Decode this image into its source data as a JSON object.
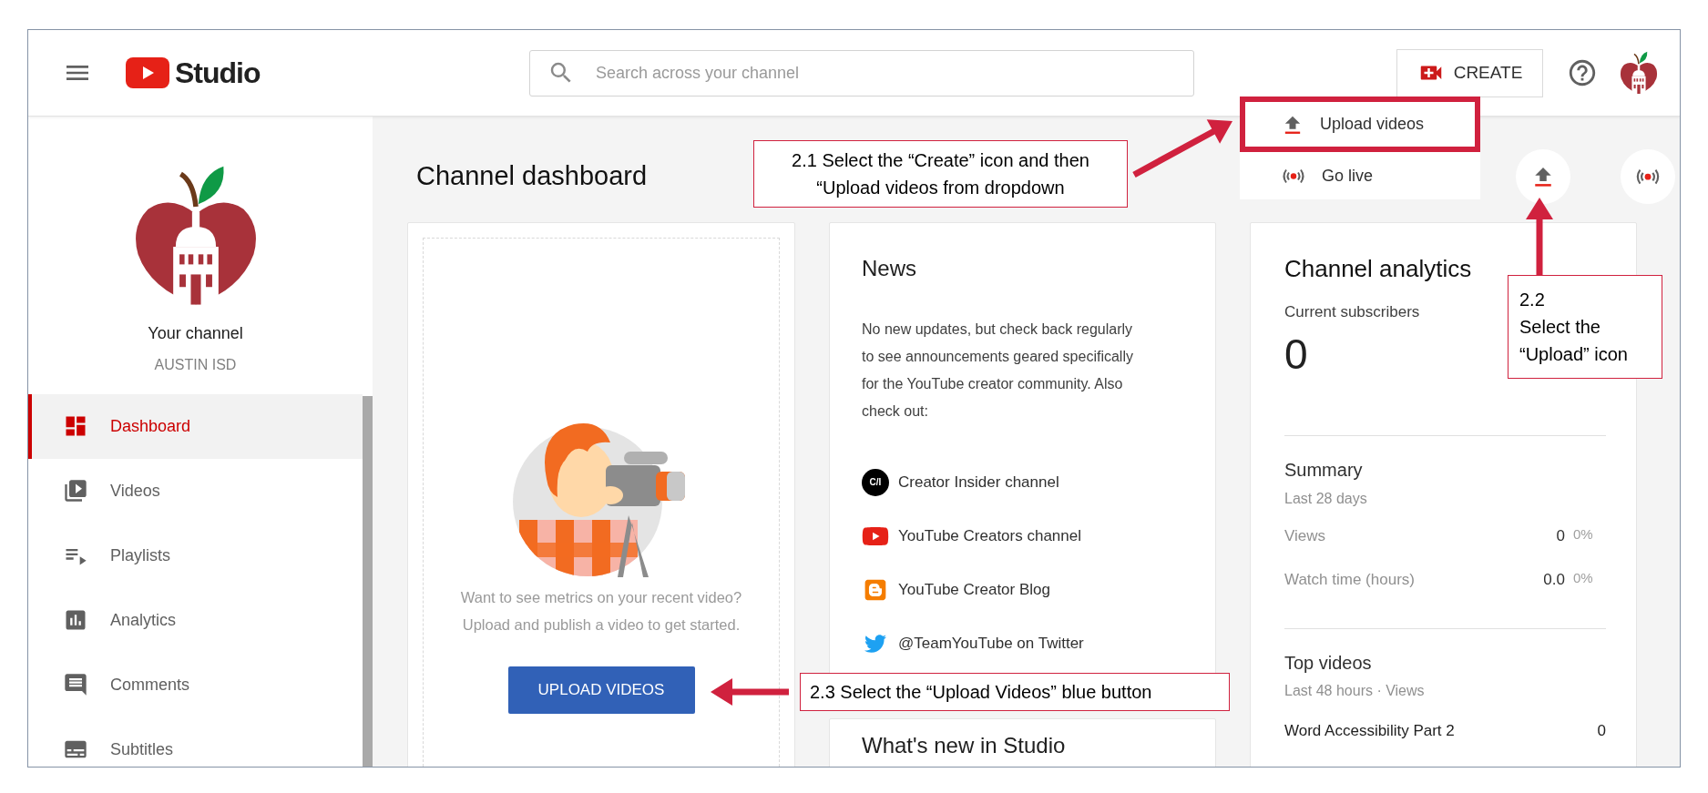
{
  "header": {
    "logo_text": "Studio",
    "search": {
      "placeholder": "Search across your channel"
    },
    "create_label": "CREATE"
  },
  "create_menu": {
    "items": [
      {
        "kind": "upload",
        "label": "Upload videos",
        "highlighted": true
      },
      {
        "kind": "live",
        "label": "Go live",
        "highlighted": false
      }
    ]
  },
  "sidebar": {
    "channel_title": "Your channel",
    "channel_name": "AUSTIN ISD",
    "items": [
      {
        "kind": "dashboard",
        "label": "Dashboard",
        "selected": true
      },
      {
        "kind": "videos",
        "label": "Videos",
        "selected": false
      },
      {
        "kind": "playlists",
        "label": "Playlists",
        "selected": false
      },
      {
        "kind": "analytics",
        "label": "Analytics",
        "selected": false
      },
      {
        "kind": "comments",
        "label": "Comments",
        "selected": false
      },
      {
        "kind": "subtitles",
        "label": "Subtitles",
        "selected": false
      }
    ]
  },
  "page_title": "Channel dashboard",
  "upload_card": {
    "message": "Want to see metrics on your recent video?\nUpload and publish a video to get started.",
    "button": "UPLOAD VIDEOS"
  },
  "news_card": {
    "title": "News",
    "body": "No new updates, but check back regularly to see announcements geared specifically for the YouTube creator community. Also check out:",
    "links": [
      {
        "kind": "creator_insider",
        "icon_text": "C/I",
        "label": "Creator Insider channel"
      },
      {
        "kind": "youtube",
        "label": "YouTube Creators channel"
      },
      {
        "kind": "blogger",
        "label": "YouTube Creator Blog"
      },
      {
        "kind": "twitter",
        "label": "@TeamYouTube on Twitter"
      }
    ]
  },
  "whats_new_card": {
    "title": "What's new in Studio"
  },
  "analytics_card": {
    "title": "Channel analytics",
    "subscribers_label": "Current subscribers",
    "subscribers": "0",
    "summary_title": "Summary",
    "summary_period": "Last 28 days",
    "metrics": [
      {
        "label": "Views",
        "value": "0",
        "change": "0%"
      },
      {
        "label": "Watch time (hours)",
        "value": "0.0",
        "change": "0%"
      }
    ],
    "top_title": "Top videos",
    "top_period": "Last 48 hours · Views",
    "top_videos": [
      {
        "title": "Word Accessibility Part 2",
        "views": "0"
      }
    ]
  },
  "annotations": [
    {
      "kind": "callout",
      "text": "2.1 Select the “Create” icon and then\n“Upload videos from dropdown"
    },
    {
      "kind": "callout",
      "text": "2.2\nSelect the\n“Upload” icon"
    },
    {
      "kind": "callout",
      "text": "2.3 Select the “Upload Videos” blue button"
    }
  ]
}
